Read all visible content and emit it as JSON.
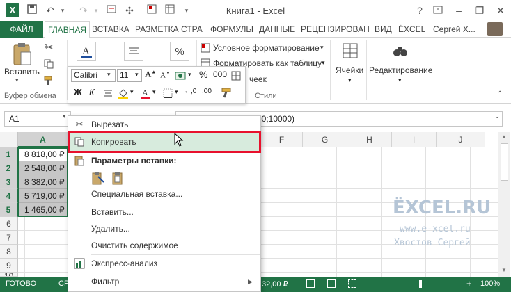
{
  "window": {
    "title": "Книга1 - Excel",
    "help": "?",
    "user_name": "Сергей Х..."
  },
  "tabs": [
    {
      "label": "ФАЙЛ"
    },
    {
      "label": "ГЛАВНАЯ"
    },
    {
      "label": "ВСТАВКА"
    },
    {
      "label": "РАЗМЕТКА СТРА"
    },
    {
      "label": "ФОРМУЛЫ"
    },
    {
      "label": "ДАННЫЕ"
    },
    {
      "label": "РЕЦЕНЗИРОВАН"
    },
    {
      "label": "ВИД"
    },
    {
      "label": "ЁXCEL"
    }
  ],
  "ribbon": {
    "paste_label": "Вставить",
    "clipboard_group": "Буфер обмена",
    "styles_group": "Стили",
    "conditional_formatting": "Условное форматирование",
    "format_as_table": "Форматировать как таблицу",
    "cell_styles_partial": "чеек",
    "cells_label": "Ячейки",
    "editing_label": "Редактирование"
  },
  "mini_toolbar": {
    "font": "Calibri",
    "size": "11",
    "bold": "Ж",
    "italic": "К",
    "percent": "%",
    "font_color_letter": "A"
  },
  "formula_bar": {
    "name_box": "A1",
    "formula_visible": "00;10000)"
  },
  "grid": {
    "selected_column": "A",
    "columns": [
      "A",
      "F",
      "G",
      "H",
      "I",
      "J"
    ],
    "rows": [
      "1",
      "2",
      "3",
      "4",
      "5",
      "6",
      "7",
      "8",
      "9",
      "10"
    ],
    "values": [
      "8 818,00 ₽",
      "2 548,00 ₽",
      "8 382,00 ₽",
      "5 719,00 ₽",
      "1 465,00 ₽"
    ]
  },
  "context_menu": {
    "items": [
      {
        "label": "Вырезать"
      },
      {
        "label": "Копировать"
      },
      {
        "label": "Параметры вставки:"
      },
      {
        "label": "Специальная вставка..."
      },
      {
        "label": "Вставить..."
      },
      {
        "label": "Удалить..."
      },
      {
        "label": "Очистить содержимое"
      },
      {
        "label": "Экспресс-анализ"
      },
      {
        "label": "Фильтр"
      }
    ],
    "highlight_color": "#e8112d",
    "hover_color": "#d7ebdd"
  },
  "status_bar": {
    "ready": "ГОТОВО",
    "partial_sum_label": "СР",
    "partial_sum_value": "32,00 ₽",
    "zoom": "100%"
  },
  "watermark": {
    "logo": "ЁXCEL.RU",
    "url": "www.e-xcel.ru",
    "author": "Хвостов Сергей"
  },
  "colors": {
    "excel_green": "#217346",
    "selection_gray": "#c6c6c6"
  }
}
